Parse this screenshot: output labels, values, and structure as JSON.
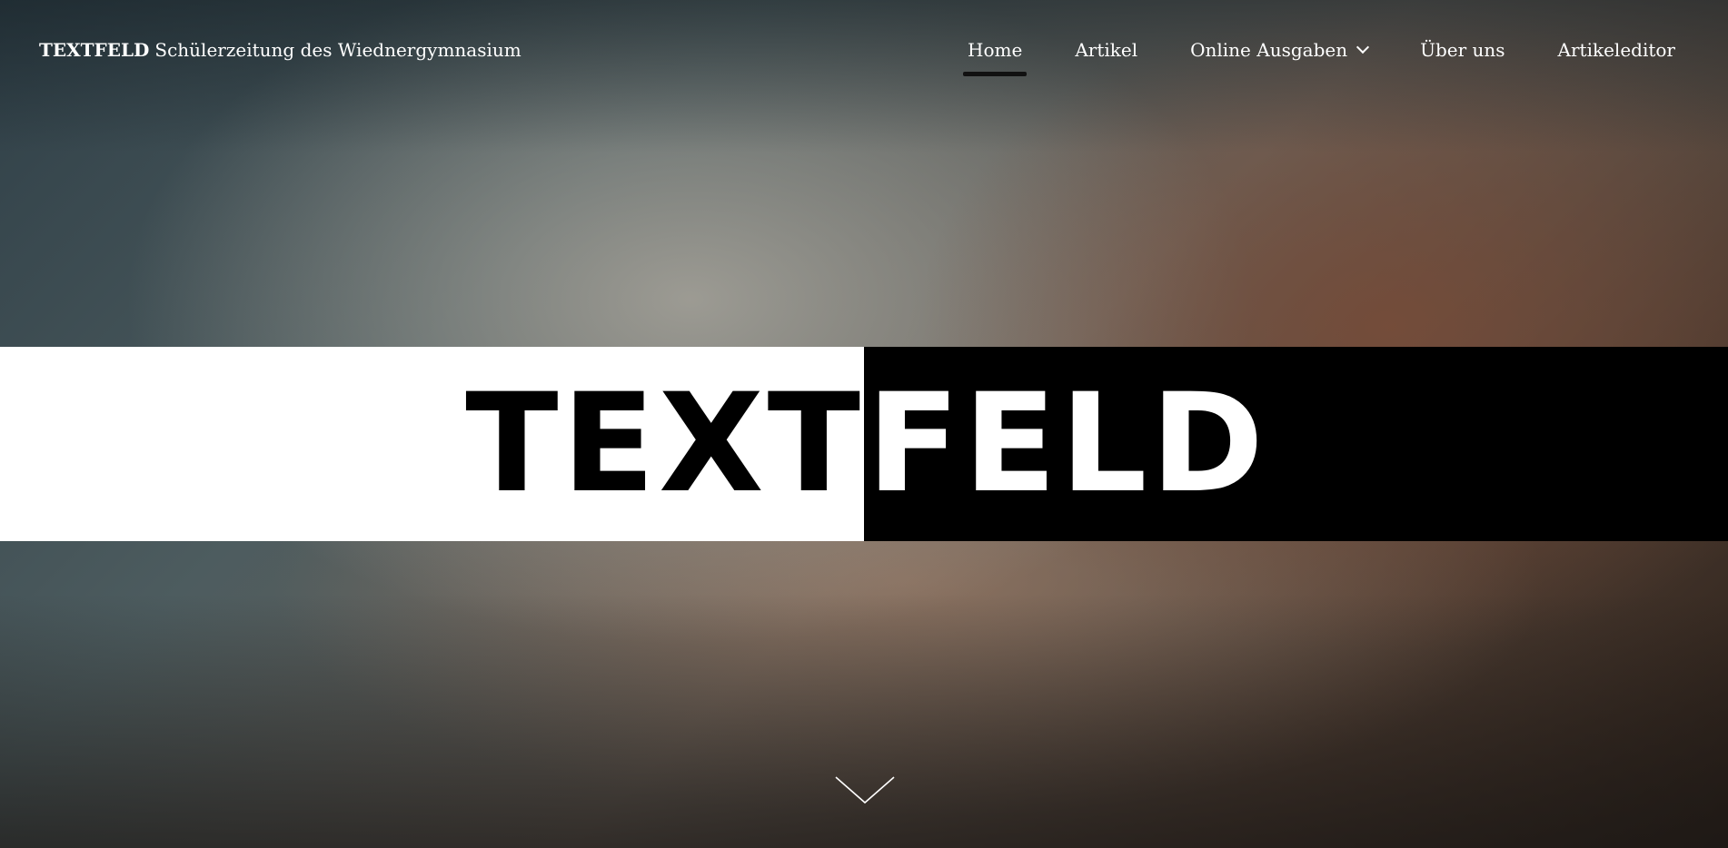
{
  "header": {
    "brand": "TEXTFELD",
    "tagline": "Schülerzeitung des Wiednergymnasium"
  },
  "nav": {
    "items": [
      {
        "label": "Home",
        "active": true
      },
      {
        "label": "Artikel"
      },
      {
        "label": "Online Ausgaben",
        "has_dropdown": true
      },
      {
        "label": "Über uns"
      },
      {
        "label": "Artikeleditor"
      }
    ],
    "dropdown_icon": "chevron-down-icon"
  },
  "hero": {
    "logo_left": "TEXT",
    "logo_right": "FELD",
    "scroll_icon": "chevron-down-icon"
  },
  "colors": {
    "band_left": "#ffffff",
    "band_right": "#000000",
    "nav_text": "#ffffff",
    "active_underline": "#111111"
  }
}
